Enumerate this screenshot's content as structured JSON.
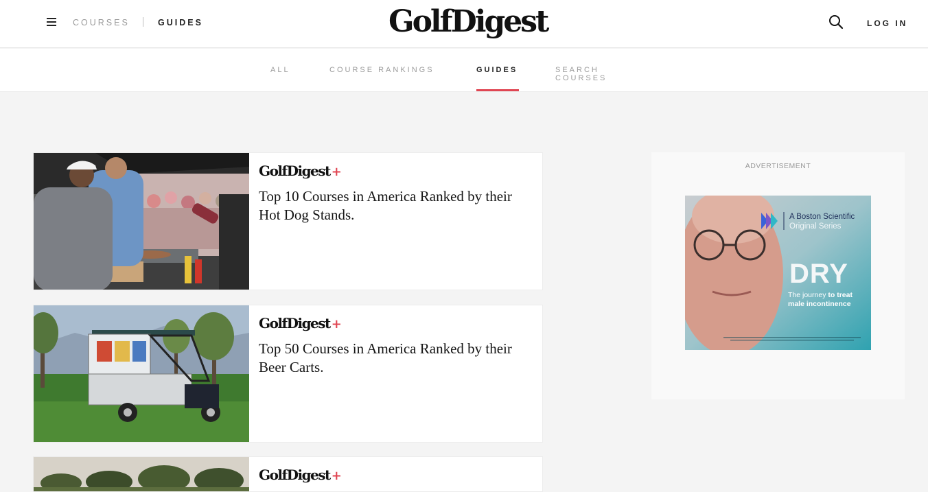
{
  "header": {
    "nav_courses": "COURSES",
    "nav_guides": "GUIDES",
    "logo_text": "GolfDigest",
    "login": "LOG IN"
  },
  "subnav": {
    "tabs": [
      {
        "label": "ALL",
        "active": false
      },
      {
        "label": "COURSE RANKINGS",
        "active": false
      },
      {
        "label": "GUIDES",
        "active": true
      },
      {
        "label": "SEARCH COURSES",
        "active": false
      }
    ],
    "accent_color": "#e04552"
  },
  "articles": [
    {
      "brand": "GolfDigest",
      "brand_plus": "+",
      "title": "Top 10 Courses in America Ranked by their Hot Dog Stands."
    },
    {
      "brand": "GolfDigest",
      "brand_plus": "+",
      "title": "Top 50 Courses in America Ranked by their Beer Carts."
    },
    {
      "brand": "GolfDigest",
      "brand_plus": "+",
      "title": ""
    }
  ],
  "advertisement": {
    "label": "ADVERTISEMENT",
    "brand_line1": "A Boston Scientific",
    "brand_line2": "Original Series",
    "title": "DRY",
    "tagline_part1": "The journey ",
    "tagline_part2": "to treat",
    "tagline_line2": "male incontinence"
  },
  "icons": {
    "menu": "hamburger-menu-icon",
    "search": "search-icon"
  }
}
